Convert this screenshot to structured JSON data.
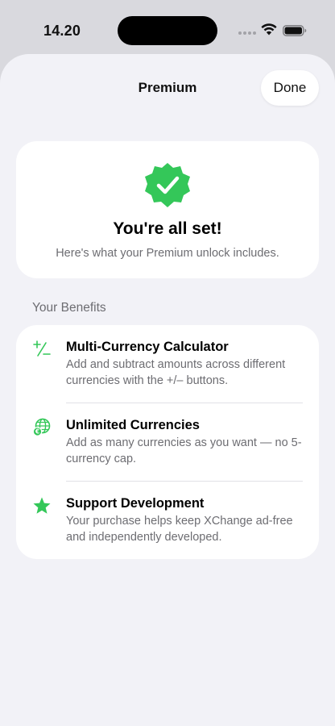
{
  "status_bar": {
    "time": "14.20"
  },
  "sheet": {
    "title": "Premium",
    "done_label": "Done"
  },
  "hero": {
    "title": "You're all set!",
    "subtitle": "Here's what your Premium unlock includes.",
    "badge_icon": "checkmark-seal-icon",
    "accent_color": "#34c759"
  },
  "benefits": {
    "header": "Your Benefits",
    "items": [
      {
        "icon": "plus-minus-icon",
        "title": "Multi-Currency Calculator",
        "description": "Add and subtract amounts across different currencies with the +/– buttons."
      },
      {
        "icon": "globe-currency-icon",
        "title": "Unlimited Currencies",
        "description": "Add as many currencies as you want — no 5-currency cap."
      },
      {
        "icon": "star-icon",
        "title": "Support Development",
        "description": "Your purchase helps keep XChange ad-free and independently developed."
      }
    ]
  },
  "colors": {
    "accent_green": "#34c759",
    "background": "#f2f2f7",
    "card": "#ffffff",
    "secondary_text": "#6d6d72"
  }
}
